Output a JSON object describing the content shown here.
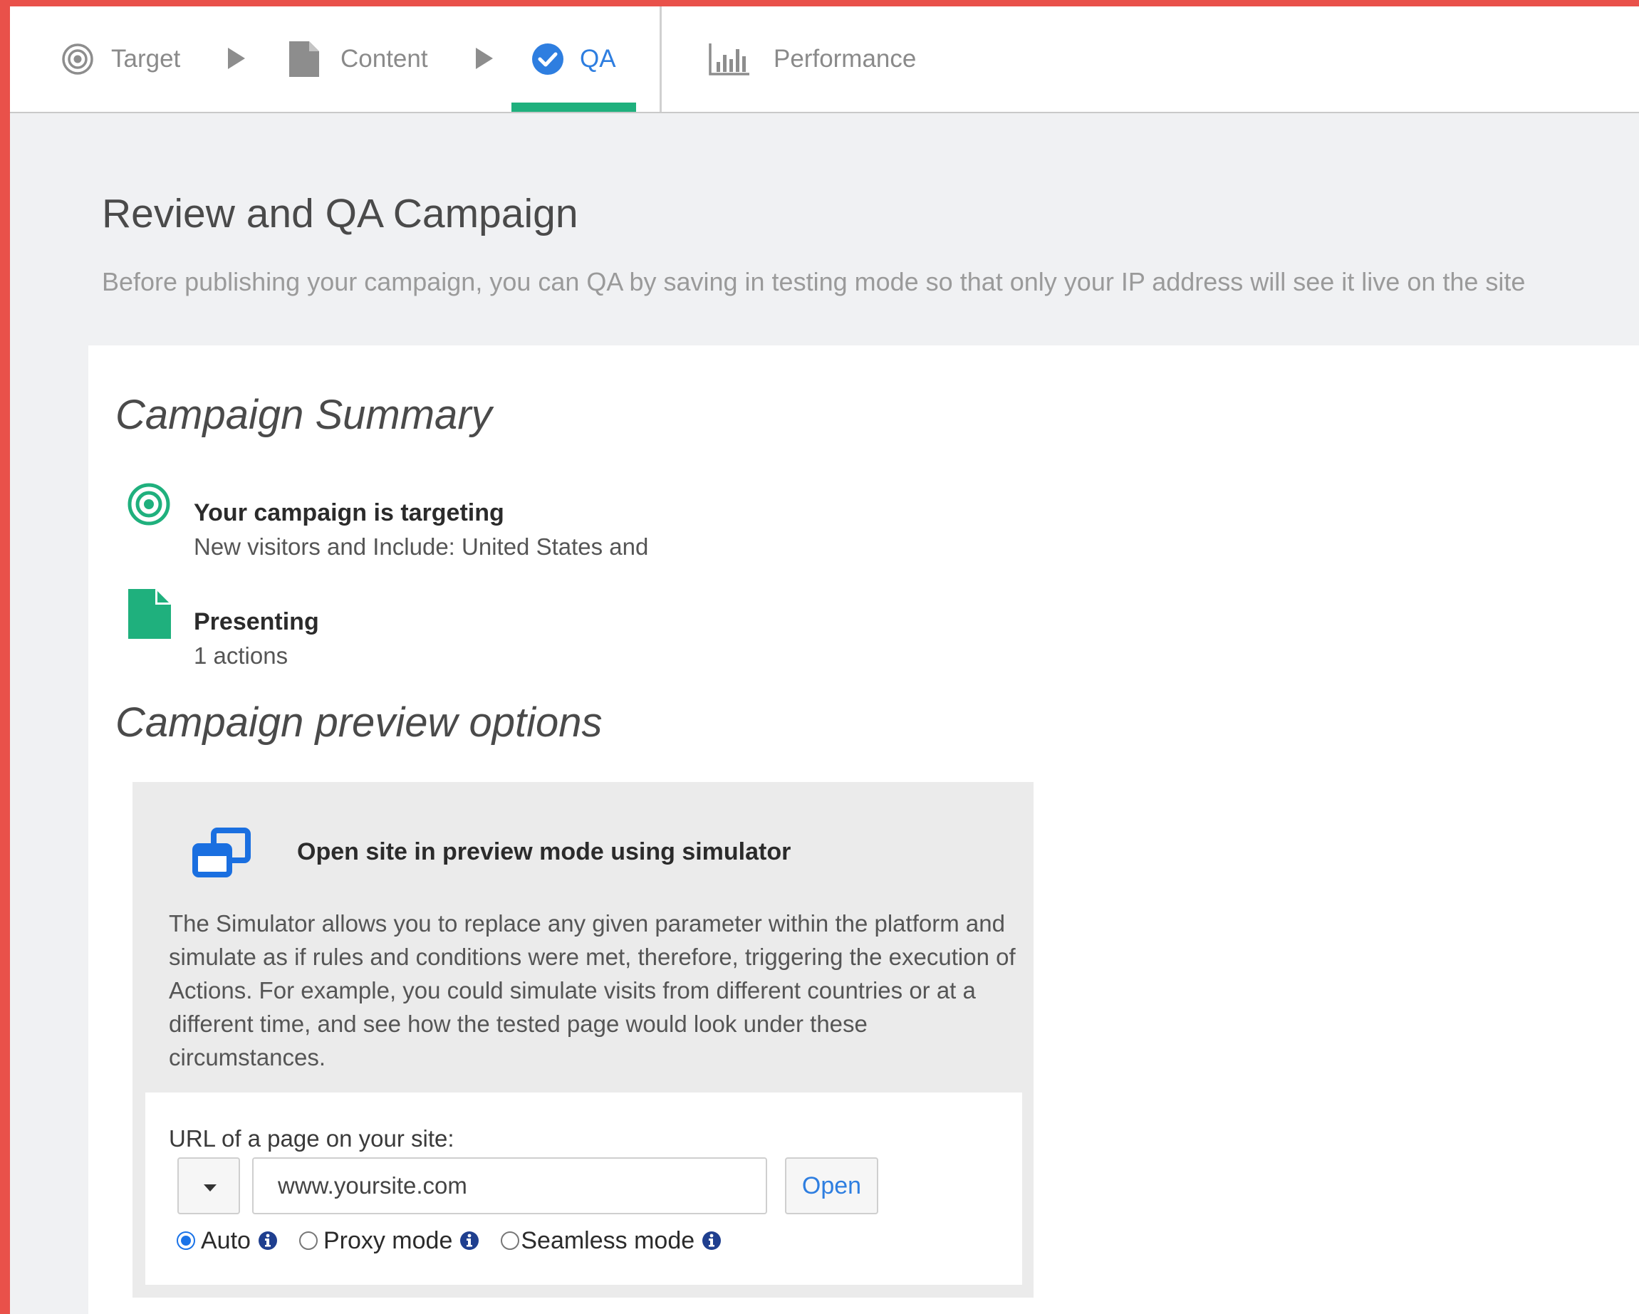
{
  "tabs": {
    "target": {
      "label": "Target",
      "icon": "target-icon"
    },
    "content": {
      "label": "Content",
      "icon": "document-icon"
    },
    "qa": {
      "label": "QA",
      "icon": "check-circle-icon",
      "active": true
    },
    "performance": {
      "label": "Performance",
      "icon": "bar-chart-icon"
    }
  },
  "header": {
    "title": "Review and QA Campaign",
    "description": "Before publishing your campaign, you can QA by saving in testing mode so that only your IP address will see it live on the site"
  },
  "summary": {
    "title": "Campaign Summary",
    "targeting": {
      "heading": "Your campaign is targeting",
      "text": "New visitors and Include: United States and",
      "icon": "target-icon"
    },
    "presenting": {
      "heading": "Presenting",
      "text": "1 actions",
      "icon": "document-icon"
    }
  },
  "preview": {
    "title": "Campaign preview options",
    "simulator": {
      "icon": "windows-icon",
      "title": "Open site in preview mode using simulator",
      "description": "The Simulator allows you to replace any given parameter within the platform and simulate as if rules and conditions were met, therefore, triggering the execution of Actions. For example, you could simulate visits from different countries or at a different time, and see how the tested page would look under these circumstances.",
      "url_label": "URL of a page on your site:",
      "url_value": "www.yoursite.com",
      "open_label": "Open",
      "modes": [
        {
          "label": "Auto",
          "selected": true
        },
        {
          "label": "Proxy mode",
          "selected": false
        },
        {
          "label": "Seamless mode",
          "selected": false
        }
      ]
    }
  },
  "colors": {
    "accent_green": "#1fb07d",
    "link_blue": "#2e7ee0",
    "frame_red": "#e9514a"
  }
}
